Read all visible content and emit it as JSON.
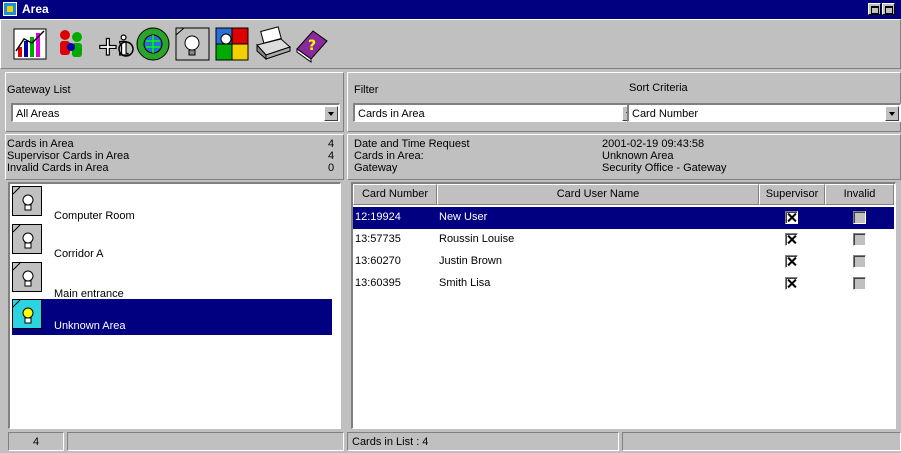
{
  "window": {
    "title": "Area"
  },
  "toolbar": {
    "icons": [
      "chart-icon",
      "people-icon",
      "add-info-icon",
      "refresh-globe-icon",
      "area-light-icon",
      "map-icon",
      "printer-icon",
      "help-book-icon"
    ]
  },
  "left": {
    "gateway_label": "Gateway List",
    "gateway_value": "All Areas",
    "summary": [
      {
        "label": "Cards in Area",
        "value": "4"
      },
      {
        "label": "Supervisor Cards in Area",
        "value": "4"
      },
      {
        "label": "Invalid Cards in Area",
        "value": "0"
      }
    ],
    "areas": [
      {
        "name": "Computer Room",
        "selected": false
      },
      {
        "name": "Corridor A",
        "selected": false
      },
      {
        "name": "Main entrance",
        "selected": false
      },
      {
        "name": "Unknown Area",
        "selected": true
      }
    ],
    "status_count": "4"
  },
  "right": {
    "filter_label": "Filter",
    "filter_value": "Cards in Area",
    "sort_label": "Sort Criteria",
    "sort_value": "Card Number",
    "info": [
      {
        "label": "Date and Time Request",
        "value": "2001-02-19 09:43:58"
      },
      {
        "label": "Cards in Area:",
        "value": "Unknown Area"
      },
      {
        "label": "Gateway",
        "value": "Security Office - Gateway"
      }
    ],
    "columns": [
      "Card Number",
      "Card User Name",
      "Supervisor",
      "Invalid"
    ],
    "rows": [
      {
        "card": "12:19924",
        "name": "New User",
        "supervisor": true,
        "invalid": false
      },
      {
        "card": "13:57735",
        "name": "Roussin Louise",
        "supervisor": true,
        "invalid": false
      },
      {
        "card": "13:60270",
        "name": "Justin Brown",
        "supervisor": true,
        "invalid": false
      },
      {
        "card": "13:60395",
        "name": "Smith  Lisa",
        "supervisor": true,
        "invalid": false
      }
    ],
    "status_text": "Cards in List : 4"
  },
  "colors": {
    "titlebar": "#000080",
    "face": "#c0c0c0",
    "selection": "#000080"
  }
}
